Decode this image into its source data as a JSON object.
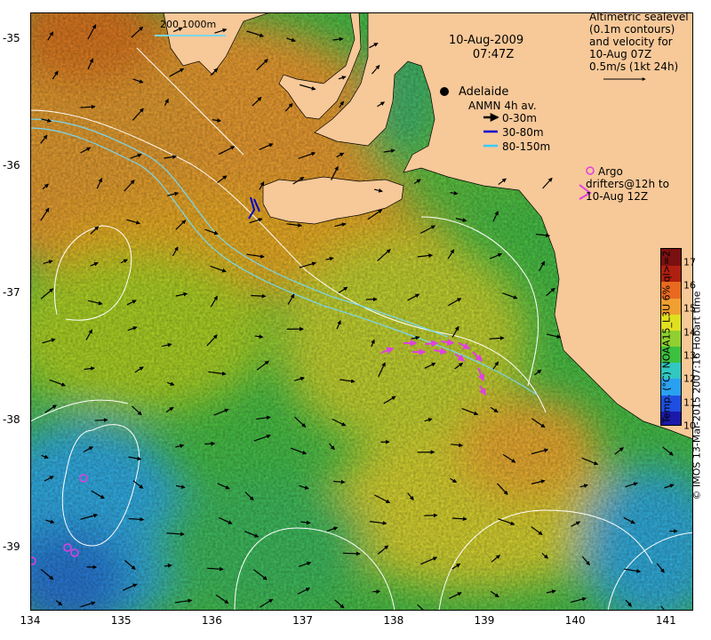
{
  "map": {
    "lon_range": [
      134,
      141.3
    ],
    "lat_range": [
      -39.5,
      -34.8
    ],
    "x_ticks": [
      "134",
      "135",
      "136",
      "137",
      "138",
      "139",
      "140",
      "141"
    ],
    "y_ticks": [
      "-35",
      "-36",
      "-37",
      "-38",
      "-39"
    ],
    "land_color": "#f7c898",
    "contour_color": "#ffffff",
    "argo_color": "#e040e0"
  },
  "overlay": {
    "date": "10-Aug-2009",
    "time": "07:47Z",
    "scale_bar": "200  1000m",
    "city": "Adelaide",
    "sealevel_legend": [
      "Altimetric sealevel",
      "(0.1m contours)",
      "and velocity for",
      "10-Aug 07Z",
      "0.5m/s (1kt 24h)"
    ],
    "anmn_title": "ANMN 4h av.",
    "anmn_items": [
      {
        "label": "0-30m",
        "color": "#000000"
      },
      {
        "label": "30-80m",
        "color": "#0000cc"
      },
      {
        "label": "80-150m",
        "color": "#33ccff"
      }
    ],
    "argo_label": "Argo",
    "drifter_lines": [
      "drifters@12h to",
      "10-Aug 12Z"
    ]
  },
  "colorbar": {
    "min": 10,
    "max": 17.6,
    "ticks": [
      "10",
      "11",
      "12",
      "13",
      "14",
      "15",
      "16",
      "17"
    ],
    "title": "Temp. (°C) NOAA15_L3U 6% ql>=2",
    "stops": [
      "#1a1aa8",
      "#1f4fe0",
      "#2aa0f0",
      "#30c8c0",
      "#3cc040",
      "#8fd030",
      "#e0e020",
      "#f0a030",
      "#e86a20",
      "#b02010",
      "#7a1010"
    ]
  },
  "credit": "© IMOS 13-Mar-2015 2007:16 Hobart time"
}
